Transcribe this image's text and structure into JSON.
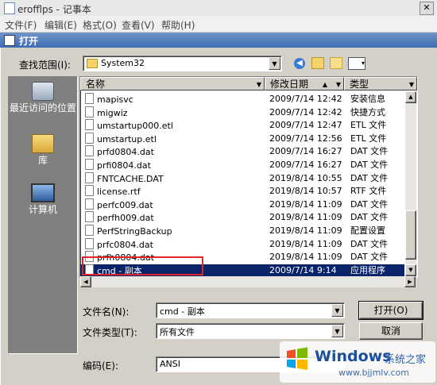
{
  "notepad": {
    "title": "erofflps - 记事本",
    "menu": [
      "文件(F)",
      "编辑(E)",
      "格式(O)",
      "查看(V)",
      "帮助(H)"
    ]
  },
  "dialog": {
    "title": "打开",
    "look_in_label": "查找范围(I):",
    "look_in_value": "System32",
    "places": [
      {
        "label": "最近访问的位置",
        "icon": "recent-places-icon"
      },
      {
        "label": "库",
        "icon": "libraries-icon"
      },
      {
        "label": "计算机",
        "icon": "computer-icon"
      }
    ],
    "columns": {
      "name": "名称",
      "date": "修改日期",
      "type": "类型"
    },
    "files": [
      {
        "name": "mapisvc",
        "date": "2009/7/14 12:42",
        "type": "安装信息"
      },
      {
        "name": "migwiz",
        "date": "2009/7/14 12:42",
        "type": "快捷方式"
      },
      {
        "name": "umstartup000.etl",
        "date": "2009/7/14 12:47",
        "type": "ETL 文件"
      },
      {
        "name": "umstartup.etl",
        "date": "2009/7/14 12:56",
        "type": "ETL 文件"
      },
      {
        "name": "prfd0804.dat",
        "date": "2009/7/14 16:27",
        "type": "DAT 文件"
      },
      {
        "name": "prfi0804.dat",
        "date": "2009/7/14 16:27",
        "type": "DAT 文件"
      },
      {
        "name": "FNTCACHE.DAT",
        "date": "2019/8/14 10:55",
        "type": "DAT 文件"
      },
      {
        "name": "license.rtf",
        "date": "2019/8/14 10:57",
        "type": "RTF 文件"
      },
      {
        "name": "perfc009.dat",
        "date": "2019/8/14 11:09",
        "type": "DAT 文件"
      },
      {
        "name": "perfh009.dat",
        "date": "2019/8/14 11:09",
        "type": "DAT 文件"
      },
      {
        "name": "PerfStringBackup",
        "date": "2019/8/14 11:09",
        "type": "配置设置"
      },
      {
        "name": "prfc0804.dat",
        "date": "2019/8/14 11:09",
        "type": "DAT 文件"
      },
      {
        "name": "prfh0804.dat",
        "date": "2019/8/14 11:09",
        "type": "DAT 文件"
      },
      {
        "name": "cmd - 副本",
        "date": "2009/7/14 9:14",
        "type": "应用程序",
        "selected": true
      }
    ],
    "filename_label": "文件名(N):",
    "filename_value": "cmd - 副本",
    "filetype_label": "文件类型(T):",
    "filetype_value": "所有文件",
    "encoding_label": "编码(E):",
    "encoding_value": "ANSI",
    "open_button": "打开(O)",
    "cancel_button": "取消"
  },
  "watermark": {
    "brand": "Windows",
    "subtitle": "系统之家",
    "url": "www.bjjmlv.com"
  },
  "colors": {
    "selection": "#0a246a",
    "highlight_box": "#e0242a",
    "dialog_bg": "#d4d0c8"
  }
}
